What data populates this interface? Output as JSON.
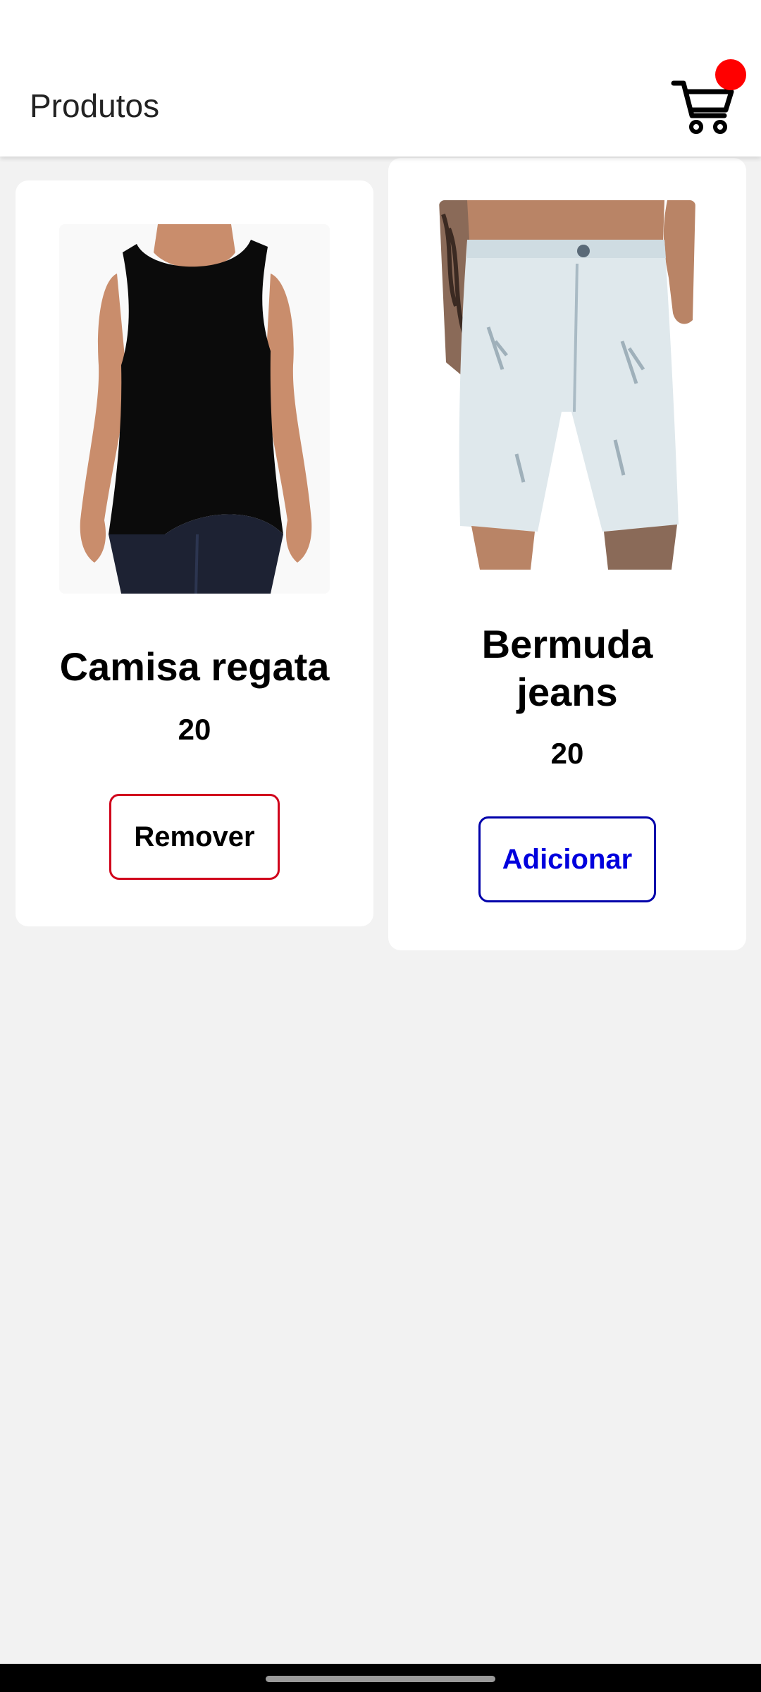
{
  "header": {
    "title": "Produtos",
    "cart_icon": "shopping-cart-icon",
    "cart_badge_color": "#ff0000"
  },
  "products": [
    {
      "name": "Camisa regata",
      "price": "20",
      "image_icon": "black-tank-top-image",
      "action_label": "Remover",
      "action_text_color": "#000000",
      "action_border_color": "#d0021b"
    },
    {
      "name": "Bermuda jeans",
      "price": "20",
      "image_icon": "light-denim-shorts-image",
      "action_label": "Adicionar",
      "action_text_color": "#0000dd",
      "action_border_color": "#0000aa"
    }
  ],
  "colors": {
    "background": "#f2f2f2",
    "card": "#ffffff"
  }
}
